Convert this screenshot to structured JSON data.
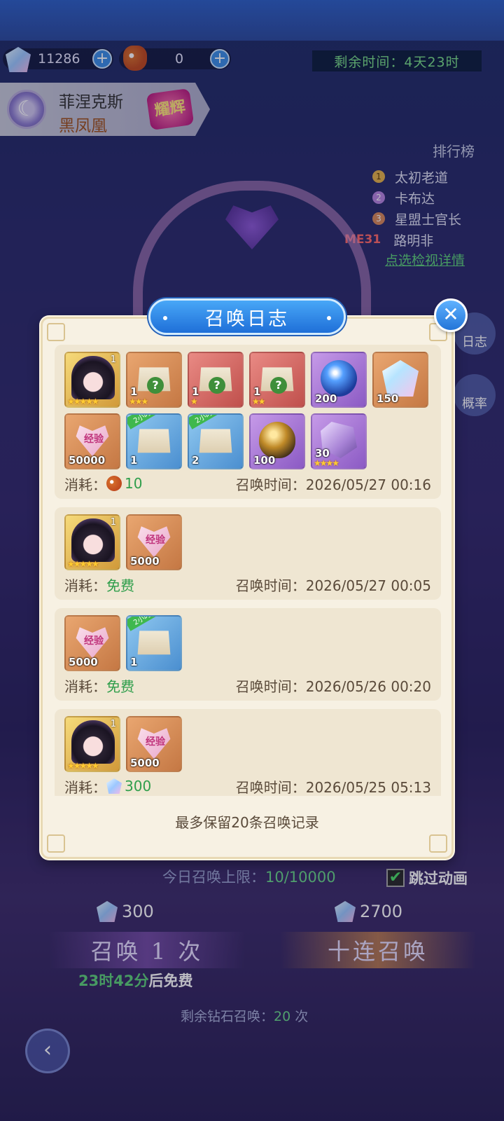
{
  "currency": {
    "diamonds": "11286",
    "tickets": "0"
  },
  "timer": {
    "label": "剩余时间：4天23时"
  },
  "character": {
    "name": "菲涅克斯",
    "title": "黑凤凰",
    "badge": "耀辉"
  },
  "ranking": {
    "title": "排行榜",
    "entries": [
      {
        "rank": "1",
        "name": "太初老道"
      },
      {
        "rank": "2",
        "name": "卡布达"
      },
      {
        "rank": "3",
        "name": "星盟士官长"
      }
    ],
    "me": {
      "tag": "ME",
      "rank": "31",
      "name": "路明非"
    },
    "detail_link": "点选检视详情"
  },
  "side_buttons": {
    "log": "日志",
    "rate": "概率"
  },
  "modal": {
    "title": "召唤日志",
    "close": "✕",
    "footnote": "最多保留20条召唤记录",
    "cost_label": "消耗：",
    "time_label": "召唤时间：",
    "entries": [
      {
        "items": [
          {
            "icon": "character-portrait-icon",
            "qty": "",
            "stars": "★★★★★",
            "level": "1"
          },
          {
            "icon": "mystery-chest-icon",
            "qty": "1",
            "stars": "★★★"
          },
          {
            "icon": "mystery-chest-icon",
            "qty": "1",
            "stars": "★"
          },
          {
            "icon": "mystery-chest-icon",
            "qty": "1",
            "stars": "★★"
          },
          {
            "icon": "crystal-orb-icon",
            "qty": "200",
            "stars": ""
          },
          {
            "icon": "diamond-icon",
            "qty": "150",
            "stars": ""
          },
          {
            "icon": "exp-heart-icon",
            "qty": "50000",
            "stars": ""
          },
          {
            "icon": "treasure-chest-icon",
            "qty": "1",
            "stars": "",
            "tag": "2小时"
          },
          {
            "icon": "gold-chest-icon",
            "qty": "2",
            "stars": "",
            "tag": "2小时"
          },
          {
            "icon": "golden-egg-icon",
            "qty": "100",
            "stars": ""
          },
          {
            "icon": "purple-shard-icon",
            "qty": "30",
            "stars": "★★★★"
          }
        ],
        "cost_value": "10",
        "cost_icon": "owl-ticket-icon",
        "time": "2026/05/27 00:16"
      },
      {
        "items": [
          {
            "icon": "character-portrait-icon",
            "qty": "",
            "stars": "★★★★★",
            "level": "1"
          },
          {
            "icon": "exp-heart-icon",
            "qty": "5000",
            "stars": ""
          }
        ],
        "cost_value": "免费",
        "cost_icon": "",
        "time": "2026/05/27 00:05"
      },
      {
        "items": [
          {
            "icon": "exp-heart-icon",
            "qty": "5000",
            "stars": ""
          },
          {
            "icon": "treasure-chest-icon",
            "qty": "1",
            "stars": "",
            "tag": "2小时"
          }
        ],
        "cost_value": "免费",
        "cost_icon": "",
        "time": "2026/05/26 00:20"
      },
      {
        "items": [
          {
            "icon": "character-portrait-icon",
            "qty": "",
            "stars": "★★★★★",
            "level": "1"
          },
          {
            "icon": "exp-heart-icon",
            "qty": "5000",
            "stars": ""
          }
        ],
        "cost_value": "300",
        "cost_icon": "diamond-icon",
        "time": "2026/05/25 05:13"
      }
    ]
  },
  "summon": {
    "daily_limit_label": "今日召唤上限：",
    "daily_limit_value": "10/10000",
    "skip_label": "跳过动画",
    "single_cost": "300",
    "ten_cost": "2700",
    "single_label": "召唤 1 次",
    "ten_label": "十连召唤",
    "free_time": "23时42分",
    "free_suffix": "后免费",
    "remain_label": "剩余钻石召唤：",
    "remain_value": "20",
    "remain_unit": " 次"
  },
  "exp_label": "经验"
}
